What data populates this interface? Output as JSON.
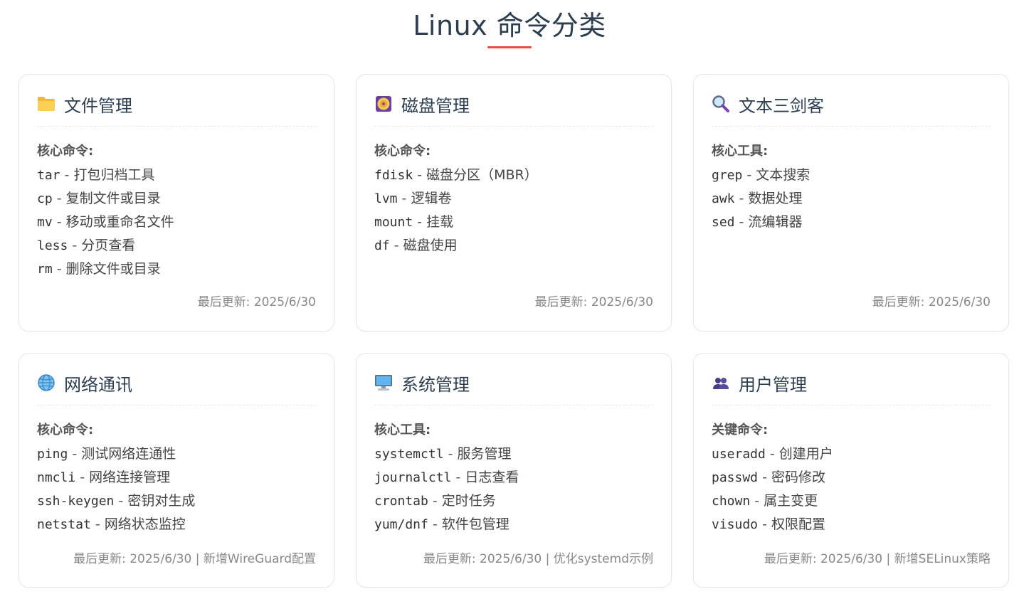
{
  "page": {
    "title": "Linux 命令分类",
    "accent_color": "#e74c3c"
  },
  "cards": [
    {
      "title": "文件管理",
      "icon": "folder-icon",
      "section_label": "核心命令:",
      "commands": [
        {
          "name": "tar",
          "desc": "打包归档工具"
        },
        {
          "name": "cp",
          "desc": "复制文件或目录"
        },
        {
          "name": "mv",
          "desc": "移动或重命名文件"
        },
        {
          "name": "less",
          "desc": "分页查看"
        },
        {
          "name": "rm",
          "desc": "删除文件或目录"
        }
      ],
      "footer": "最后更新: 2025/6/30"
    },
    {
      "title": "磁盘管理",
      "icon": "disk-icon",
      "section_label": "核心命令:",
      "commands": [
        {
          "name": "fdisk",
          "desc": "磁盘分区（MBR）"
        },
        {
          "name": "lvm",
          "desc": "逻辑卷"
        },
        {
          "name": "mount",
          "desc": "挂载"
        },
        {
          "name": "df",
          "desc": "磁盘使用"
        }
      ],
      "footer": "最后更新: 2025/6/30"
    },
    {
      "title": "文本三剑客",
      "icon": "magnifier-icon",
      "section_label": "核心工具:",
      "commands": [
        {
          "name": "grep",
          "desc": "文本搜索"
        },
        {
          "name": "awk",
          "desc": "数据处理"
        },
        {
          "name": "sed",
          "desc": "流编辑器"
        }
      ],
      "footer": "最后更新: 2025/6/30"
    },
    {
      "title": "网络通讯",
      "icon": "globe-icon",
      "section_label": "核心命令:",
      "commands": [
        {
          "name": "ping",
          "desc": "测试网络连通性"
        },
        {
          "name": "nmcli",
          "desc": "网络连接管理"
        },
        {
          "name": "ssh-keygen",
          "desc": "密钥对生成"
        },
        {
          "name": "netstat",
          "desc": "网络状态监控"
        }
      ],
      "footer": "最后更新: 2025/6/30 | 新增WireGuard配置"
    },
    {
      "title": "系统管理",
      "icon": "computer-icon",
      "section_label": "核心工具:",
      "commands": [
        {
          "name": "systemctl",
          "desc": "服务管理"
        },
        {
          "name": "journalctl",
          "desc": "日志查看"
        },
        {
          "name": "crontab",
          "desc": "定时任务"
        },
        {
          "name": "yum/dnf",
          "desc": "软件包管理"
        }
      ],
      "footer": "最后更新: 2025/6/30 | 优化systemd示例"
    },
    {
      "title": "用户管理",
      "icon": "users-icon",
      "section_label": "关键命令:",
      "commands": [
        {
          "name": "useradd",
          "desc": "创建用户"
        },
        {
          "name": "passwd",
          "desc": "密码修改"
        },
        {
          "name": "chown",
          "desc": "属主变更"
        },
        {
          "name": "visudo",
          "desc": "权限配置"
        }
      ],
      "footer": "最后更新: 2025/6/30 | 新增SELinux策略"
    }
  ],
  "separator": " - "
}
